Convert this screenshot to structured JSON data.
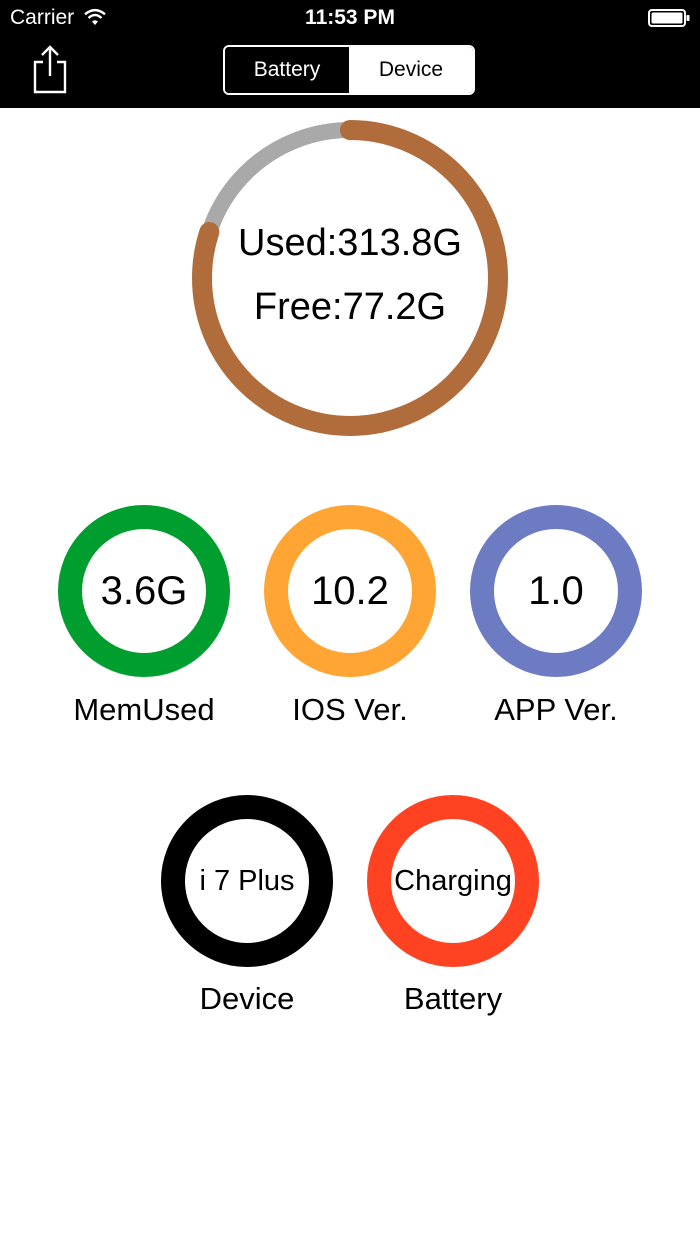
{
  "status_bar": {
    "carrier": "Carrier",
    "time": "11:53 PM"
  },
  "nav": {
    "segments": [
      "Battery",
      "Device"
    ],
    "selected": "Battery"
  },
  "storage": {
    "used_label": "Used:313.8G",
    "free_label": "Free:77.2G",
    "used_fraction": 0.8,
    "used_color": "#B06C3B",
    "free_color": "#A9A9A9"
  },
  "gauges": [
    {
      "value": "3.6G",
      "label": "MemUsed",
      "color": "#009E2E",
      "fill": 1.0
    },
    {
      "value": "10.2",
      "label": "IOS Ver.",
      "color": "#FFA533",
      "fill": 1.0
    },
    {
      "value": "1.0",
      "label": "APP Ver.",
      "color": "#6D7BC3",
      "fill": 1.0
    },
    {
      "value": "i 7 Plus",
      "label": "Device",
      "color": "#000000",
      "fill": 1.0
    },
    {
      "value": "Charging",
      "label": "Battery",
      "color": "#FF4322",
      "fill": 1.0
    }
  ]
}
